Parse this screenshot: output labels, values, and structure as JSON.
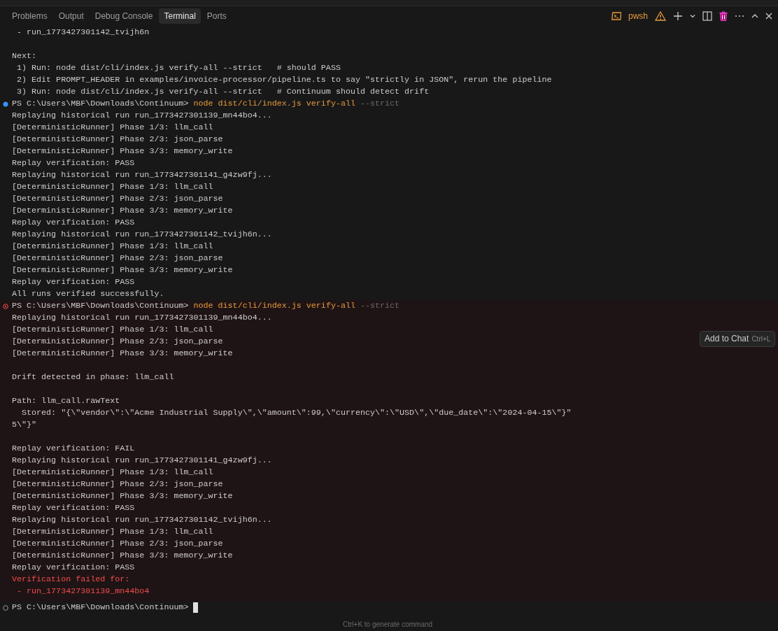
{
  "tabs": [
    {
      "label": "Problems",
      "selected": false
    },
    {
      "label": "Output",
      "selected": false
    },
    {
      "label": "Debug Console",
      "selected": false
    },
    {
      "label": "Terminal",
      "selected": true
    },
    {
      "label": "Ports",
      "selected": false
    }
  ],
  "toolbar": {
    "shell": "pwsh"
  },
  "intro_lines": [
    {
      "kind": "normal",
      "text": " - run_1773427301142_tvijh6n"
    },
    {
      "kind": "blank"
    },
    {
      "kind": "normal",
      "text": "Next:"
    },
    {
      "kind": "normal",
      "text": " 1) Run: node dist/cli/index.js verify-all --strict   # should PASS"
    },
    {
      "kind": "normal",
      "text": " 2) Edit PROMPT_HEADER in examples/invoice-processor/pipeline.ts to say \"strictly in JSON\", rerun the pipeline"
    },
    {
      "kind": "normal",
      "text": " 3) Run: node dist/cli/index.js verify-all --strict   # Continuum should detect drift"
    }
  ],
  "command_blocks": [
    {
      "kind": "success",
      "prompt": "PS C:\\Users\\MBF\\Downloads\\Continuum>",
      "command": "node dist/cli/index.js verify-all",
      "flag": "--strict",
      "lines": [
        {
          "kind": "normal",
          "text": "Replaying historical run run_1773427301139_mn44bo4..."
        },
        {
          "kind": "normal",
          "text": "[DeterministicRunner] Phase 1/3: llm_call"
        },
        {
          "kind": "normal",
          "text": "[DeterministicRunner] Phase 2/3: json_parse"
        },
        {
          "kind": "normal",
          "text": "[DeterministicRunner] Phase 3/3: memory_write"
        },
        {
          "kind": "normal",
          "text": "Replay verification: PASS"
        },
        {
          "kind": "normal",
          "text": "Replaying historical run run_1773427301141_g4zw9fj..."
        },
        {
          "kind": "normal",
          "text": "[DeterministicRunner] Phase 1/3: llm_call"
        },
        {
          "kind": "normal",
          "text": "[DeterministicRunner] Phase 2/3: json_parse"
        },
        {
          "kind": "normal",
          "text": "[DeterministicRunner] Phase 3/3: memory_write"
        },
        {
          "kind": "normal",
          "text": "Replay verification: PASS"
        },
        {
          "kind": "normal",
          "text": "Replaying historical run run_1773427301142_tvijh6n..."
        },
        {
          "kind": "normal",
          "text": "[DeterministicRunner] Phase 1/3: llm_call"
        },
        {
          "kind": "normal",
          "text": "[DeterministicRunner] Phase 2/3: json_parse"
        },
        {
          "kind": "normal",
          "text": "[DeterministicRunner] Phase 3/3: memory_write"
        },
        {
          "kind": "normal",
          "text": "Replay verification: PASS"
        },
        {
          "kind": "normal",
          "text": "All runs verified successfully."
        }
      ]
    },
    {
      "kind": "error",
      "prompt": "PS C:\\Users\\MBF\\Downloads\\Continuum>",
      "command": "node dist/cli/index.js verify-all",
      "flag": "--strict",
      "lines": [
        {
          "kind": "normal",
          "text": "Replaying historical run run_1773427301139_mn44bo4..."
        },
        {
          "kind": "normal",
          "text": "[DeterministicRunner] Phase 1/3: llm_call"
        },
        {
          "kind": "normal",
          "text": "[DeterministicRunner] Phase 2/3: json_parse"
        },
        {
          "kind": "normal",
          "text": "[DeterministicRunner] Phase 3/3: memory_write"
        },
        {
          "kind": "blank"
        },
        {
          "kind": "normal",
          "text": "Drift detected in phase: llm_call"
        },
        {
          "kind": "blank"
        },
        {
          "kind": "normal",
          "text": "Path: llm_call.rawText"
        },
        {
          "kind": "normal",
          "text": "  Stored: \"{\\\"vendor\\\":\\\"Acme Industrial Supply\\\",\\\"amount\\\":99,\\\"currency\\\":\\\"USD\\\",\\\"due_date\\\":\\\"2024-04-15\\\"}\""
        },
        {
          "kind": "normal",
          "text": "5\\\"}\""
        },
        {
          "kind": "blank"
        },
        {
          "kind": "normal",
          "text": "Replay verification: FAIL"
        },
        {
          "kind": "normal",
          "text": "Replaying historical run run_1773427301141_g4zw9fj..."
        },
        {
          "kind": "normal",
          "text": "[DeterministicRunner] Phase 1/3: llm_call"
        },
        {
          "kind": "normal",
          "text": "[DeterministicRunner] Phase 2/3: json_parse"
        },
        {
          "kind": "normal",
          "text": "[DeterministicRunner] Phase 3/3: memory_write"
        },
        {
          "kind": "normal",
          "text": "Replay verification: PASS"
        },
        {
          "kind": "normal",
          "text": "Replaying historical run run_1773427301142_tvijh6n..."
        },
        {
          "kind": "normal",
          "text": "[DeterministicRunner] Phase 1/3: llm_call"
        },
        {
          "kind": "normal",
          "text": "[DeterministicRunner] Phase 2/3: json_parse"
        },
        {
          "kind": "normal",
          "text": "[DeterministicRunner] Phase 3/3: memory_write"
        },
        {
          "kind": "normal",
          "text": "Replay verification: PASS"
        },
        {
          "kind": "error",
          "text": "Verification failed for:"
        },
        {
          "kind": "error",
          "text": " - run_1773427301139_mn44bo4"
        }
      ]
    },
    {
      "kind": "pending",
      "prompt": "PS C:\\Users\\MBF\\Downloads\\Continuum>"
    }
  ],
  "tooltip": {
    "label": "Add to Chat",
    "shortcut": "Ctrl+L"
  },
  "hint": "Ctrl+K to generate command"
}
